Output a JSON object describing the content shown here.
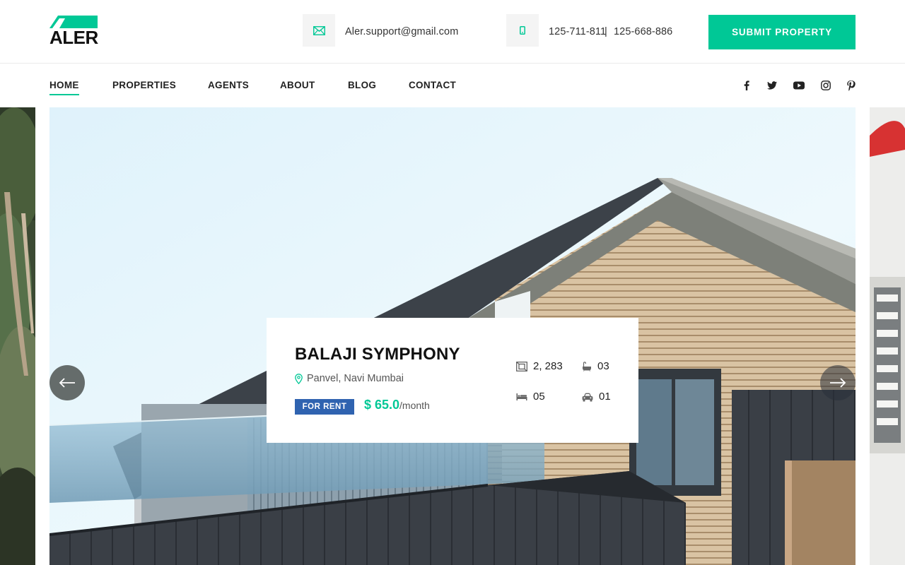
{
  "brand": {
    "name": "ALER",
    "accent": "#00c896",
    "badge_blue": "#2f63b0"
  },
  "header": {
    "email": "Aler.support@gmail.com",
    "phone_1": "125-711-811",
    "phone_separator": "|",
    "phone_2": "125-668-886",
    "submit_label": "SUBMIT PROPERTY",
    "icons": [
      "envelope-icon",
      "mobile-phone-icon"
    ]
  },
  "nav": {
    "items": [
      "HOME",
      "PROPERTIES",
      "AGENTS",
      "ABOUT",
      "BLOG",
      "CONTACT"
    ],
    "active": "HOME",
    "social": [
      "facebook-icon",
      "twitter-icon",
      "youtube-icon",
      "instagram-icon",
      "pinterest-icon"
    ]
  },
  "slider": {
    "prev_icon": "arrow-left-icon",
    "next_icon": "arrow-right-icon",
    "property": {
      "title": "BALAJI SYMPHONY",
      "location": "Panvel, Navi Mumbai",
      "status": "FOR RENT",
      "price": "$ 65.0",
      "period": "/month",
      "area": "2, 283",
      "baths": "03",
      "beds": "05",
      "garages": "01"
    }
  }
}
